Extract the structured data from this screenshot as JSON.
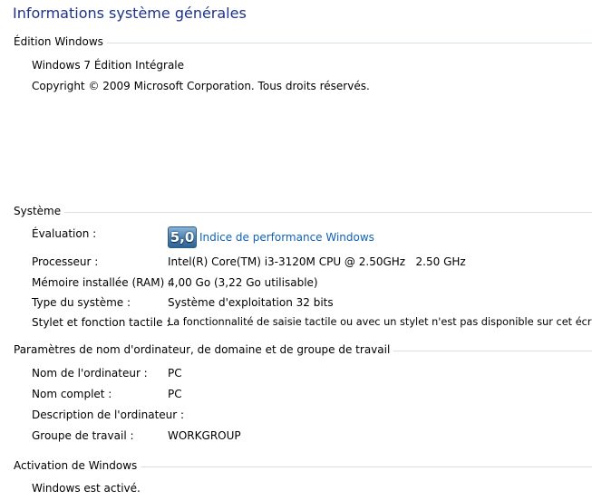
{
  "page": {
    "title": "Informations système générales"
  },
  "windows_edition": {
    "heading": "Édition Windows",
    "edition": "Windows 7 Édition Intégrale",
    "copyright": "Copyright © 2009 Microsoft Corporation. Tous droits réservés."
  },
  "system": {
    "heading": "Système",
    "rating_label": "Évaluation :",
    "rating_score": "5,0",
    "rating_link": "Indice de performance Windows",
    "rows": [
      {
        "label": "Processeur :",
        "value": "Intel(R) Core(TM) i3-3120M CPU @ 2.50GHz   2.50 GHz"
      },
      {
        "label": "Mémoire installée (RAM) :",
        "value": "4,00 Go (3,22 Go utilisable)"
      },
      {
        "label": "Type du système :",
        "value": "Système d'exploitation 32 bits"
      },
      {
        "label": "Stylet et fonction tactile :",
        "value": "La fonctionnalité de saisie tactile ou avec un stylet n'est pas disponible sur cet écran"
      }
    ]
  },
  "computer_name": {
    "heading": "Paramètres de nom d'ordinateur, de domaine et de groupe de travail",
    "rows": [
      {
        "label": "Nom de l'ordinateur :",
        "value": "PC"
      },
      {
        "label": "Nom complet :",
        "value": "PC"
      },
      {
        "label": "Description de l'ordinateur :",
        "value": ""
      },
      {
        "label": "Groupe de travail :",
        "value": "WORKGROUP"
      }
    ]
  },
  "activation": {
    "heading": "Activation de Windows",
    "status": "Windows est activé."
  }
}
